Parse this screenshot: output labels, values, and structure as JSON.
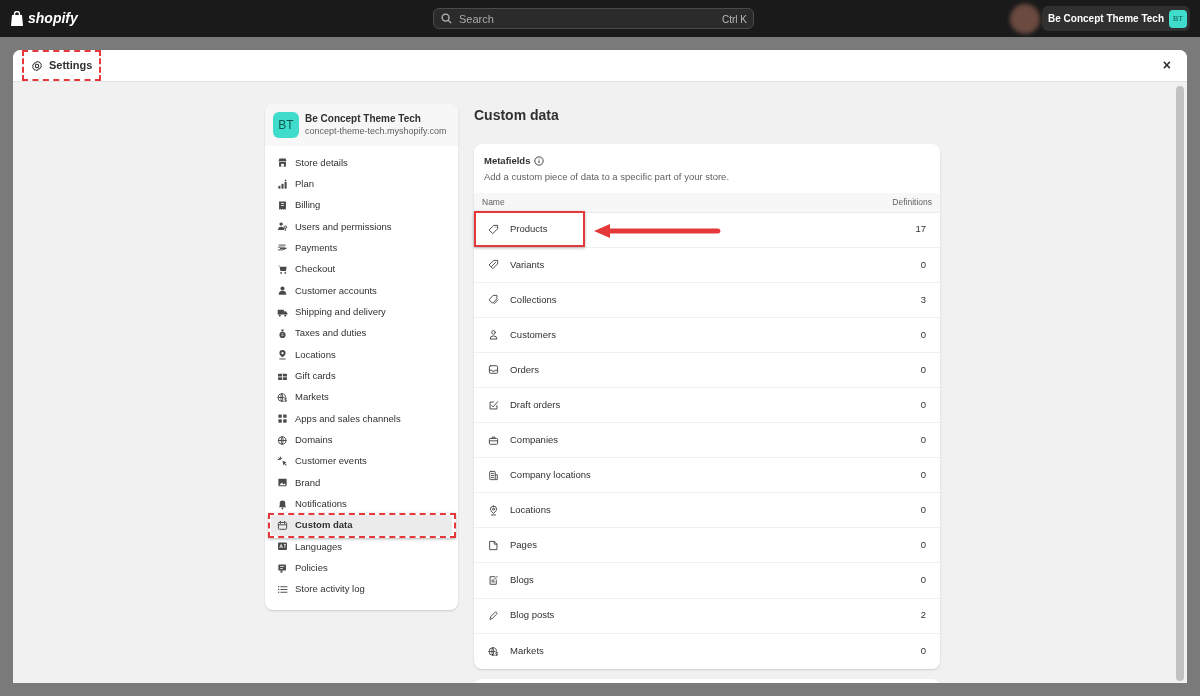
{
  "topbar": {
    "logo": "shopify",
    "search": {
      "placeholder": "Search",
      "shortcut": "Ctrl K"
    },
    "store_button": {
      "label": "Be Concept Theme Tech",
      "initials": "BT"
    }
  },
  "modal": {
    "title": "Settings",
    "title_annotated": true,
    "close": "×"
  },
  "store": {
    "initials": "BT",
    "name": "Be Concept Theme Tech",
    "domain": "concept-theme-tech.myshopify.com"
  },
  "sidebar": {
    "items": [
      {
        "label": "Store details",
        "selected": false,
        "annotated": false
      },
      {
        "label": "Plan",
        "selected": false,
        "annotated": false
      },
      {
        "label": "Billing",
        "selected": false,
        "annotated": false
      },
      {
        "label": "Users and permissions",
        "selected": false,
        "annotated": false
      },
      {
        "label": "Payments",
        "selected": false,
        "annotated": false
      },
      {
        "label": "Checkout",
        "selected": false,
        "annotated": false
      },
      {
        "label": "Customer accounts",
        "selected": false,
        "annotated": false
      },
      {
        "label": "Shipping and delivery",
        "selected": false,
        "annotated": false
      },
      {
        "label": "Taxes and duties",
        "selected": false,
        "annotated": false
      },
      {
        "label": "Locations",
        "selected": false,
        "annotated": false
      },
      {
        "label": "Gift cards",
        "selected": false,
        "annotated": false
      },
      {
        "label": "Markets",
        "selected": false,
        "annotated": false
      },
      {
        "label": "Apps and sales channels",
        "selected": false,
        "annotated": false
      },
      {
        "label": "Domains",
        "selected": false,
        "annotated": false
      },
      {
        "label": "Customer events",
        "selected": false,
        "annotated": false
      },
      {
        "label": "Brand",
        "selected": false,
        "annotated": false
      },
      {
        "label": "Notifications",
        "selected": false,
        "annotated": false
      },
      {
        "label": "Custom data",
        "selected": true,
        "annotated": true
      },
      {
        "label": "Languages",
        "selected": false,
        "annotated": false
      },
      {
        "label": "Policies",
        "selected": false,
        "annotated": false
      },
      {
        "label": "Store activity log",
        "selected": false,
        "annotated": false
      }
    ]
  },
  "page_title": "Custom data",
  "metafields": {
    "title": "Metafields",
    "description": "Add a custom piece of data to a specific part of your store.",
    "columns": [
      "Name",
      "Definitions"
    ],
    "rows": [
      {
        "name": "Products",
        "definitions": "17",
        "annotated": true
      },
      {
        "name": "Variants",
        "definitions": "0",
        "annotated": false
      },
      {
        "name": "Collections",
        "definitions": "3",
        "annotated": false
      },
      {
        "name": "Customers",
        "definitions": "0",
        "annotated": false
      },
      {
        "name": "Orders",
        "definitions": "0",
        "annotated": false
      },
      {
        "name": "Draft orders",
        "definitions": "0",
        "annotated": false
      },
      {
        "name": "Companies",
        "definitions": "0",
        "annotated": false
      },
      {
        "name": "Company locations",
        "definitions": "0",
        "annotated": false
      },
      {
        "name": "Locations",
        "definitions": "0",
        "annotated": false
      },
      {
        "name": "Pages",
        "definitions": "0",
        "annotated": false
      },
      {
        "name": "Blogs",
        "definitions": "0",
        "annotated": false
      },
      {
        "name": "Blog posts",
        "definitions": "2",
        "annotated": false
      },
      {
        "name": "Markets",
        "definitions": "0",
        "annotated": false
      }
    ]
  }
}
